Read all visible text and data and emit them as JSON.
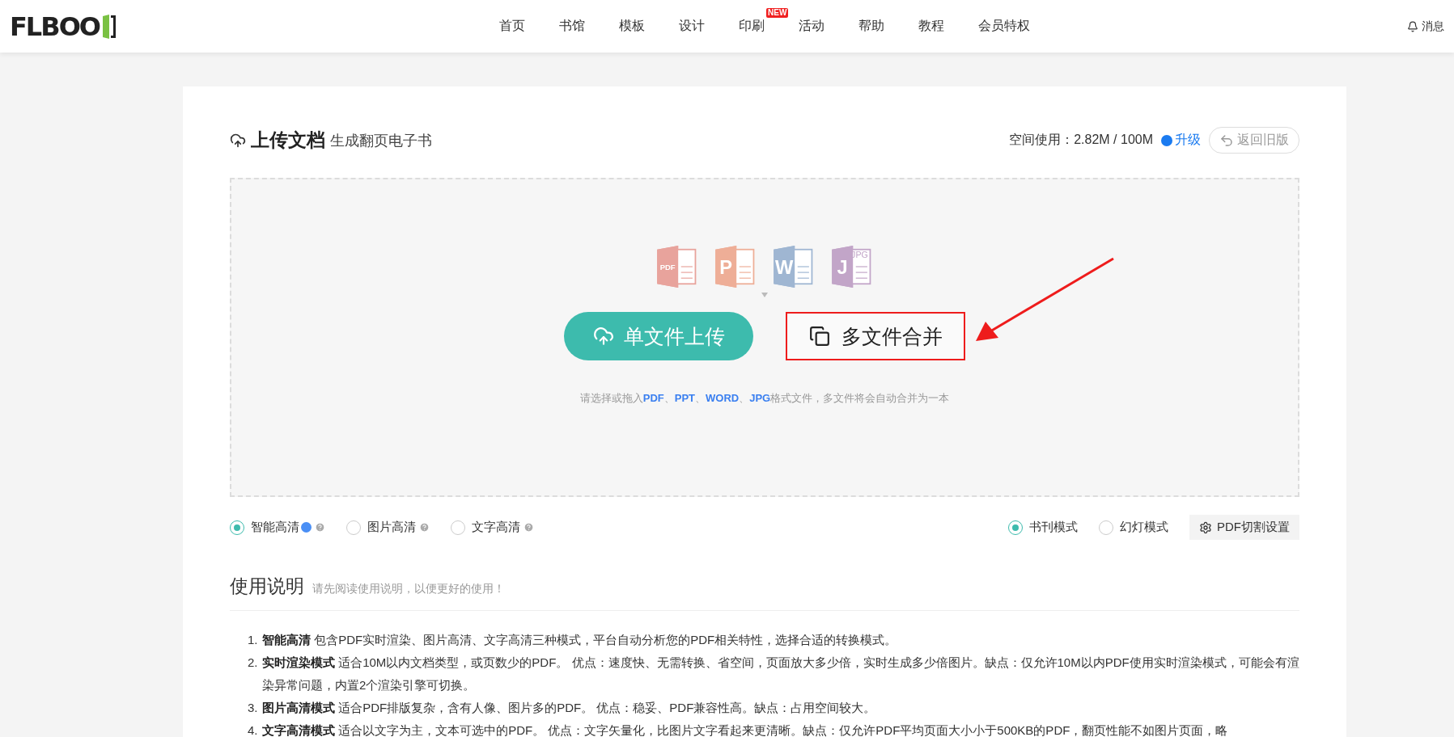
{
  "header": {
    "logo": "FLBOO",
    "nav": [
      {
        "label": "首页"
      },
      {
        "label": "书馆"
      },
      {
        "label": "模板"
      },
      {
        "label": "设计"
      },
      {
        "label": "印刷",
        "badge": "NEW"
      },
      {
        "label": "活动"
      },
      {
        "label": "帮助"
      },
      {
        "label": "教程"
      },
      {
        "label": "会员特权"
      }
    ],
    "messages": "消息"
  },
  "upload": {
    "title": "上传文档",
    "subtitle": "生成翻页电子书",
    "space_label": "空间使用：2.82M / 100M",
    "upgrade": "升级",
    "back_button": "返回旧版",
    "file_types": [
      {
        "letter": "PDF",
        "color": "#e8a39c"
      },
      {
        "letter": "P",
        "color": "#eeae97"
      },
      {
        "letter": "W",
        "color": "#9fb6d2"
      },
      {
        "letter": "J",
        "color": "#c2a5c8",
        "tag": "JPG"
      }
    ],
    "single_button": "单文件上传",
    "multi_button": {
      "label": "多文件合并",
      "highlighted": true
    },
    "hint": "请选择或拖入**PDF**、**PPT**、**WORD**、**JPG**格式文件，多文件将会自动合并为一本"
  },
  "quality_options": [
    {
      "label": "智能高清",
      "selected": true,
      "recommended": true
    },
    {
      "label": "图片高清",
      "selected": false,
      "recommended": false
    },
    {
      "label": "文字高清",
      "selected": false,
      "recommended": false
    }
  ],
  "mode_options": [
    {
      "label": "书刊模式",
      "selected": true
    },
    {
      "label": "幻灯模式",
      "selected": false
    }
  ],
  "pdf_settings": "PDF切割设置",
  "instructions": {
    "title": "使用说明",
    "subtitle": "请先阅读使用说明，以便更好的使用！",
    "items": [
      {
        "number": "1.",
        "text": "**智能高清** 包含PDF实时渲染、图片高清、文字高清三种模式，平台自动分析您的PDF相关特性，选择合适的转换模式。"
      },
      {
        "number": "2.",
        "text": "**实时渲染模式** 适合10M以内文档类型，或页数少的PDF。 优点：速度快、无需转换、省空间，页面放大多少倍，实时生成多少倍图片。缺点：仅允许10M以内PDF使用实时渲染模式，可能会有渲染异常问题，内置2个渲染引擎可切换。"
      },
      {
        "number": "3.",
        "text": "**图片高清模式** 适合PDF排版复杂，含有人像、图片多的PDF。 优点：稳妥、PDF兼容性高。缺点：占用空间较大。"
      },
      {
        "number": "4.",
        "text": "**文字高清模式** 适合以文字为主，文本可选中的PDF。 优点：文字矢量化，比图片文字看起来更清晰。缺点：仅允许PDF平均页面大小小于500KB的PDF，翻页性能不如图片页面，略"
      }
    ]
  }
}
